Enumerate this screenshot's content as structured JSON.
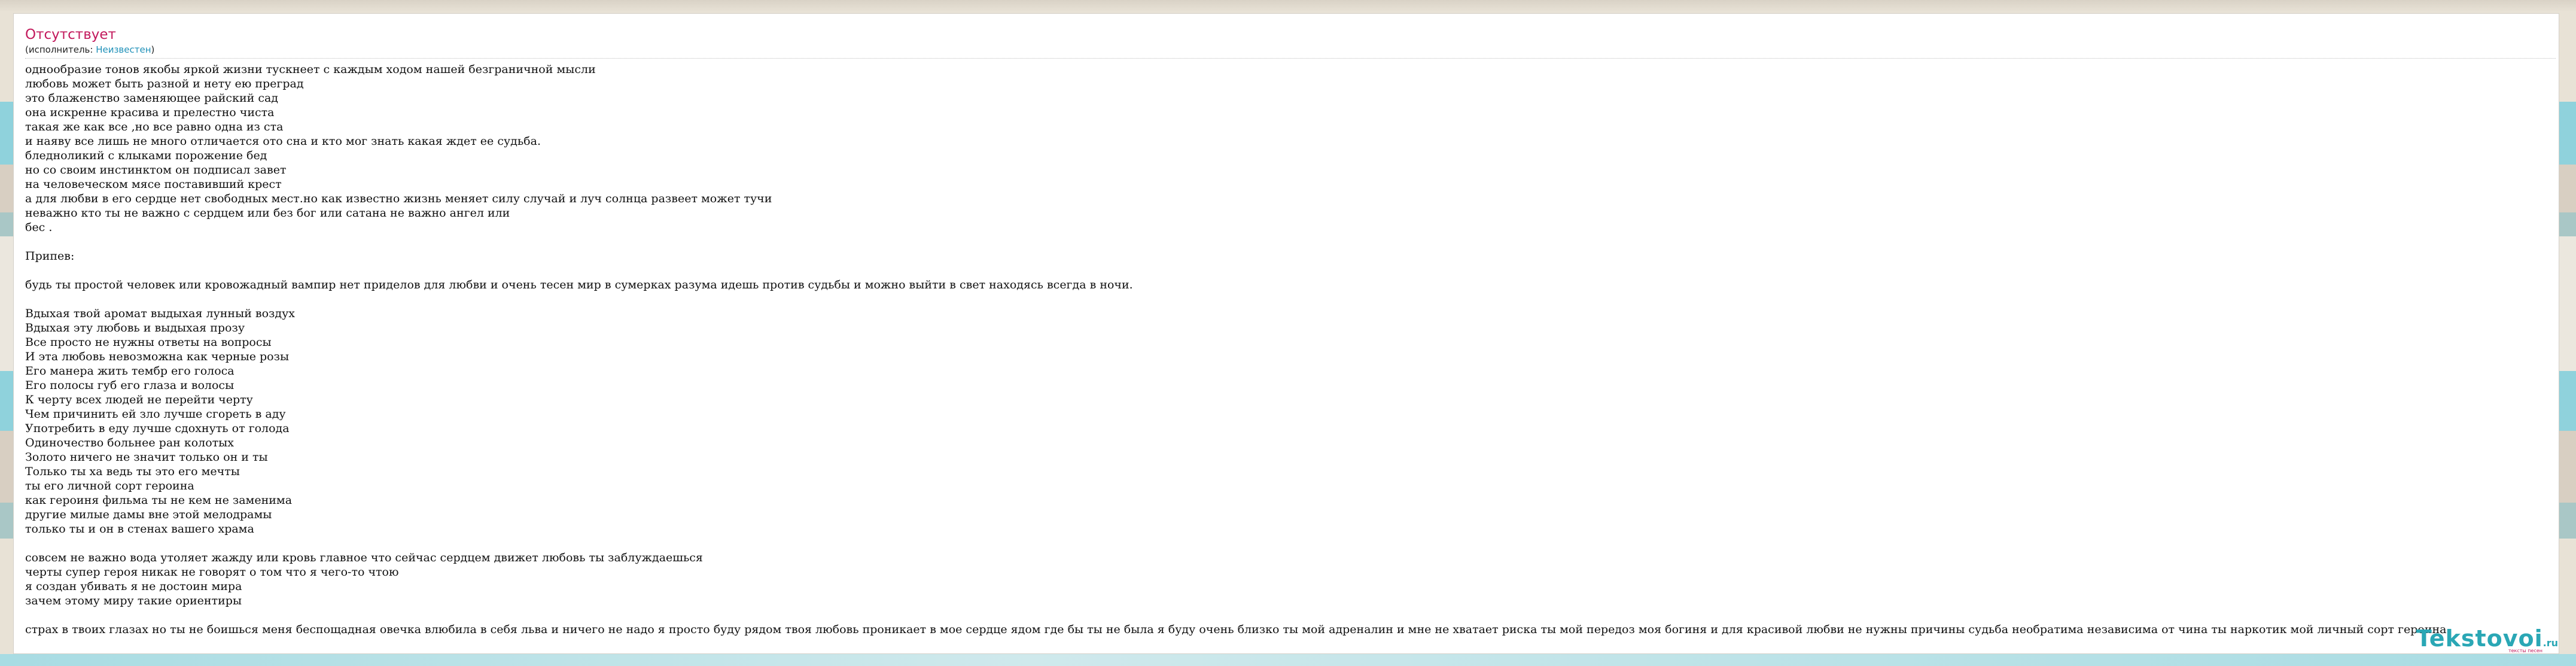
{
  "song": {
    "title": "Отсутствует",
    "performer_prefix": "(исполнитель: ",
    "performer_name": "Неизвестен",
    "performer_suffix": ")"
  },
  "lyrics": [
    "однообразие тонов якобы яркой жизни тускнеет с каждым ходом нашей безграничной мысли",
    "любовь может быть разной и нету ею преград",
    "это блаженство заменяющее райский сад",
    "она искренне красива и прелестно чиста",
    "такая же как все ,но все равно одна из ста",
    "и наяву все лишь не много отличается ото сна и кто мог знать какая ждет ее судьба.",
    "бледноликий с клыками порожение бед",
    "но со своим инстинктом он подписал завет",
    "на человеческом мясе поставивший крест",
    "а для любви в его сердце нет свободных мест.но как известно жизнь меняет силу случай и луч солнца развеет может тучи",
    "неважно кто ты не важно с сердцем или без бог или сатана не важно ангел или",
    "бес .",
    "",
    "Припев:",
    "",
    "будь ты простой человек или кровожадный вампир нет приделов для любви и очень тесен мир в сумерках разума идешь против судьбы и можно выйти в свет находясь всегда в ночи.",
    "",
    "Вдыхая твой аромат выдыхая лунный воздух",
    "Вдыхая эту любовь и выдыхая прозу",
    "Все просто не нужны ответы на вопросы",
    "И эта любовь невозможна как черные розы",
    "Его манера жить тембр его голоса",
    "Его полосы губ его глаза и волосы",
    "К черту всех людей не перейти черту",
    "Чем причинить ей зло лучше сгореть в аду",
    "Употребить в еду лучше сдохнуть от голода",
    "Одиночество больнее ран колотых",
    "Золото ничего не значит только он и ты",
    "Только ты ха ведь ты это его мечты",
    "ты его личной сорт героина",
    "как героиня фильма ты не кем не заменима",
    "другие милые дамы вне этой мелодрамы",
    "только ты и он в стенах вашего храма",
    "",
    "совсем не важно вода утоляет жажду или кровь главное что сейчас сердцем движет любовь ты заблуждаешься",
    "черты супер героя никак не говорят о том что я чего-то чтою",
    "я создан убивать я не достоин мира",
    "зачем этому миру такие ориентиры",
    "",
    "страх в твоих глазах но ты не боишься меня беспощадная овечка влюбила в себя льва и ничего не надо я просто буду рядом твоя любовь проникает в мое сердце ядом где бы ты не была я буду очень близко ты мой адреналин и мне не хватает риска ты мой передоз моя богиня и для красивой любви не нужны причины судьба необратима независима от чина ты наркотик мой личный сорт героина."
  ],
  "logo": {
    "name": "Tekstovoi",
    "tld": ".ru",
    "tagline": "тексты песен"
  },
  "colors": {
    "title": "#c2185b",
    "link": "#1e90b8",
    "logo": "#2aa7b5"
  }
}
